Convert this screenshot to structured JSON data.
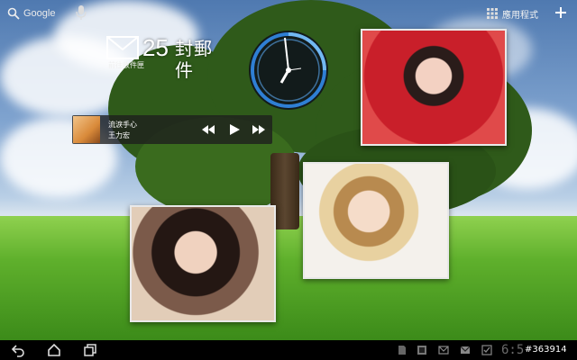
{
  "search": {
    "label": "Google"
  },
  "apps": {
    "label": "應用程式"
  },
  "mail": {
    "count": "25",
    "suffix": "封郵件",
    "subtitle": "前往收件匣"
  },
  "music": {
    "title": "流淚手心",
    "artist": "王力宏"
  },
  "status": {
    "time": "6:5"
  },
  "watermark": "#363914",
  "colors": {
    "navbar": "#000000",
    "clock_ring": "#2f7fd4",
    "music_bg": "#1e1e1e"
  },
  "icons": {
    "search": "search-icon",
    "mic": "mic-icon",
    "apps": "apps-grid-icon",
    "add": "add-icon",
    "mail": "envelope-icon",
    "prev": "previous-icon",
    "play": "play-icon",
    "next": "next-icon",
    "back": "back-icon",
    "home": "home-icon",
    "recent": "recent-apps-icon"
  }
}
